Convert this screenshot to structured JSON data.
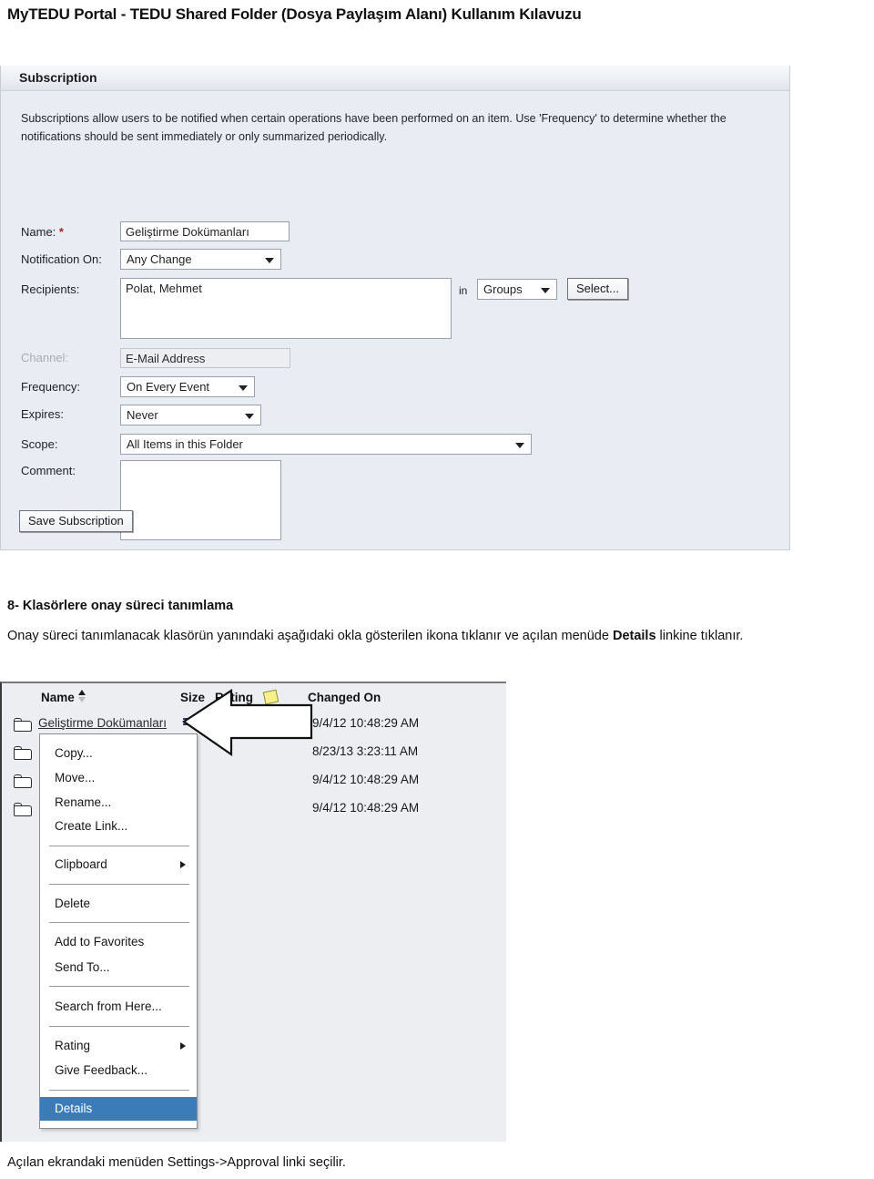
{
  "document": {
    "title": "MyTEDU Portal - TEDU Shared Folder (Dosya Paylaşım Alanı) Kullanım Kılavuzu"
  },
  "subscription_panel": {
    "header": "Subscription",
    "intro": "Subscriptions allow users to be notified when certain operations have been performed on an item. Use 'Frequency' to determine whether the notifications should be sent immediately or only summarized periodically.",
    "fields": {
      "name_label": "Name:",
      "name_required": "*",
      "name_value": "Geliştirme Dokümanları",
      "notification_label": "Notification On:",
      "notification_value": "Any Change",
      "recipients_label": "Recipients:",
      "recipients_value": "Polat, Mehmet",
      "in_word": "in",
      "scope_dropdown_value": "Groups",
      "select_button": "Select...",
      "channel_label": "Channel:",
      "channel_value": "E-Mail Address",
      "frequency_label": "Frequency:",
      "frequency_value": "On Every Event",
      "expires_label": "Expires:",
      "expires_value": "Never",
      "scope_label": "Scope:",
      "scope_value": "All Items in this Folder",
      "comment_label": "Comment:",
      "comment_value": ""
    },
    "save_button": "Save Subscription"
  },
  "section": {
    "heading": "8- Klasörlere onay süreci tanımlama",
    "paragraph_part1": "Onay süreci tanımlanacak klasörün yanındaki aşağıdaki okla gösterilen ikona tıklanır ve açılan menüde ",
    "paragraph_bold": "Details",
    "paragraph_part2": " linkine tıklanır."
  },
  "file_list": {
    "columns": {
      "name": "Name",
      "size": "Size",
      "rating": "Rating",
      "changed_on": "Changed On"
    },
    "rows": [
      {
        "name": "Geliştirme Dokümanları",
        "changed_on": "9/4/12 10:48:29 AM"
      },
      {
        "name": "",
        "changed_on": "8/23/13 3:23:11 AM"
      },
      {
        "name": "",
        "changed_on": "9/4/12 10:48:29 AM"
      },
      {
        "name": "",
        "changed_on": "9/4/12 10:48:29 AM"
      }
    ]
  },
  "context_menu": {
    "items": [
      {
        "label": "Copy...",
        "submenu": false,
        "selected": false
      },
      {
        "label": "Move...",
        "submenu": false,
        "selected": false
      },
      {
        "label": "Rename...",
        "submenu": false,
        "selected": false
      },
      {
        "label": "Create Link...",
        "submenu": false,
        "selected": false
      },
      {
        "label": "Clipboard",
        "submenu": true,
        "selected": false
      },
      {
        "label": "Delete",
        "submenu": false,
        "selected": false
      },
      {
        "label": "Add to Favorites",
        "submenu": false,
        "selected": false
      },
      {
        "label": "Send To...",
        "submenu": false,
        "selected": false
      },
      {
        "label": "Search from Here...",
        "submenu": false,
        "selected": false
      },
      {
        "label": "Rating",
        "submenu": true,
        "selected": false
      },
      {
        "label": "Give Feedback...",
        "submenu": false,
        "selected": false
      },
      {
        "label": "Details",
        "submenu": false,
        "selected": true
      }
    ],
    "highlight_color": "#3b7cb8"
  },
  "footer": {
    "caption": "Açılan ekrandaki menüden Settings->Approval linki seçilir."
  }
}
